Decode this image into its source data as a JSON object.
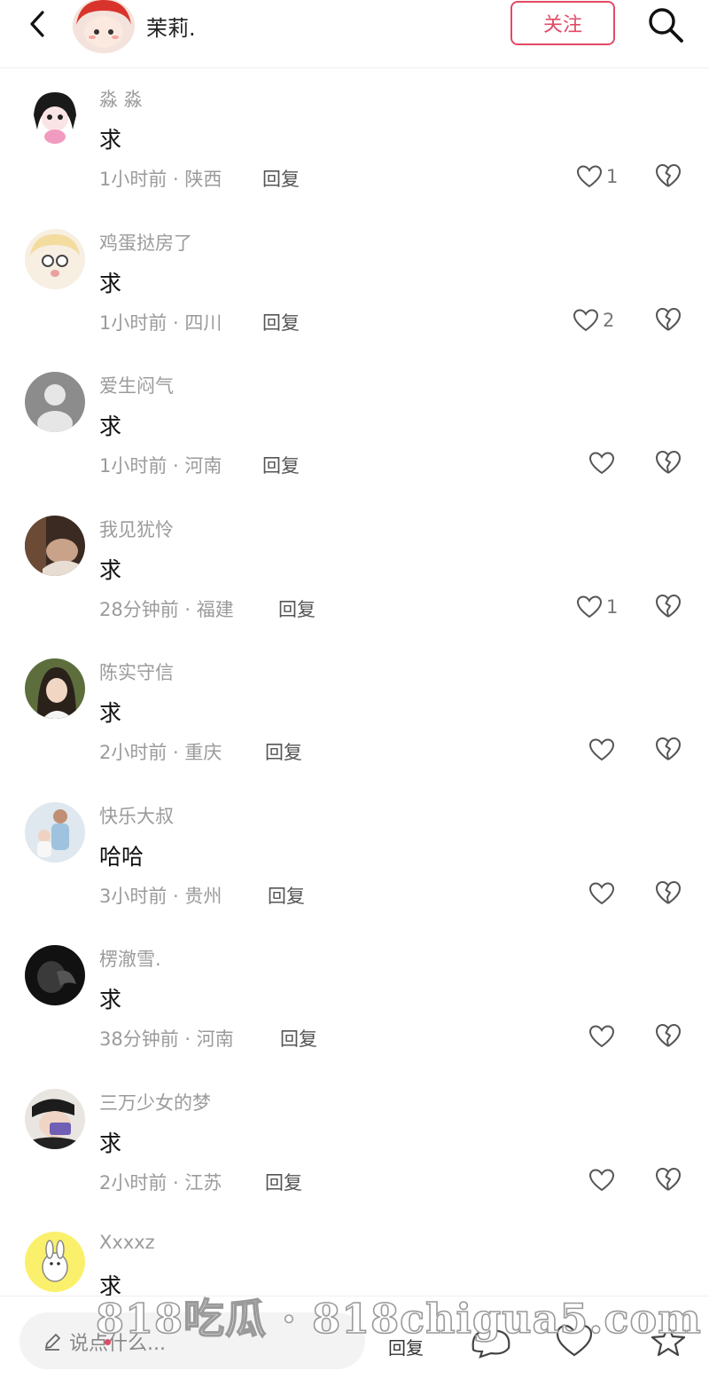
{
  "header": {
    "username": "茉莉.",
    "follow_label": "关注"
  },
  "reply_label": "回复",
  "comments": [
    {
      "user": "淼 淼",
      "text": "求",
      "meta": "1小时前 · 陕西",
      "likes": "1"
    },
    {
      "user": "鸡蛋挞房了",
      "text": "求",
      "meta": "1小时前 · 四川",
      "likes": "2"
    },
    {
      "user": "爱生闷气",
      "text": "求",
      "meta": "1小时前 · 河南",
      "likes": ""
    },
    {
      "user": "我见犹怜",
      "text": "求",
      "meta": "28分钟前 · 福建",
      "likes": "1"
    },
    {
      "user": "陈实守信",
      "text": "求",
      "meta": "2小时前 · 重庆",
      "likes": ""
    },
    {
      "user": "快乐大叔",
      "text": "哈哈",
      "meta": "3小时前 · 贵州",
      "likes": ""
    },
    {
      "user": "楞澈雪.",
      "text": "求",
      "meta": "38分钟前 · 河南",
      "likes": ""
    },
    {
      "user": "三万少女的梦",
      "text": "求",
      "meta": "2小时前 · 江苏",
      "likes": ""
    },
    {
      "user": "Xxxxz",
      "text": "求",
      "meta": "",
      "likes": ""
    }
  ],
  "bottom": {
    "placeholder": "说点什么...",
    "reply_icon_label": "回复"
  },
  "watermark": "818吃瓜 · 818chigua5.com",
  "colors": {
    "accent": "#e24a65",
    "meta_text": "#9b9b9b"
  }
}
